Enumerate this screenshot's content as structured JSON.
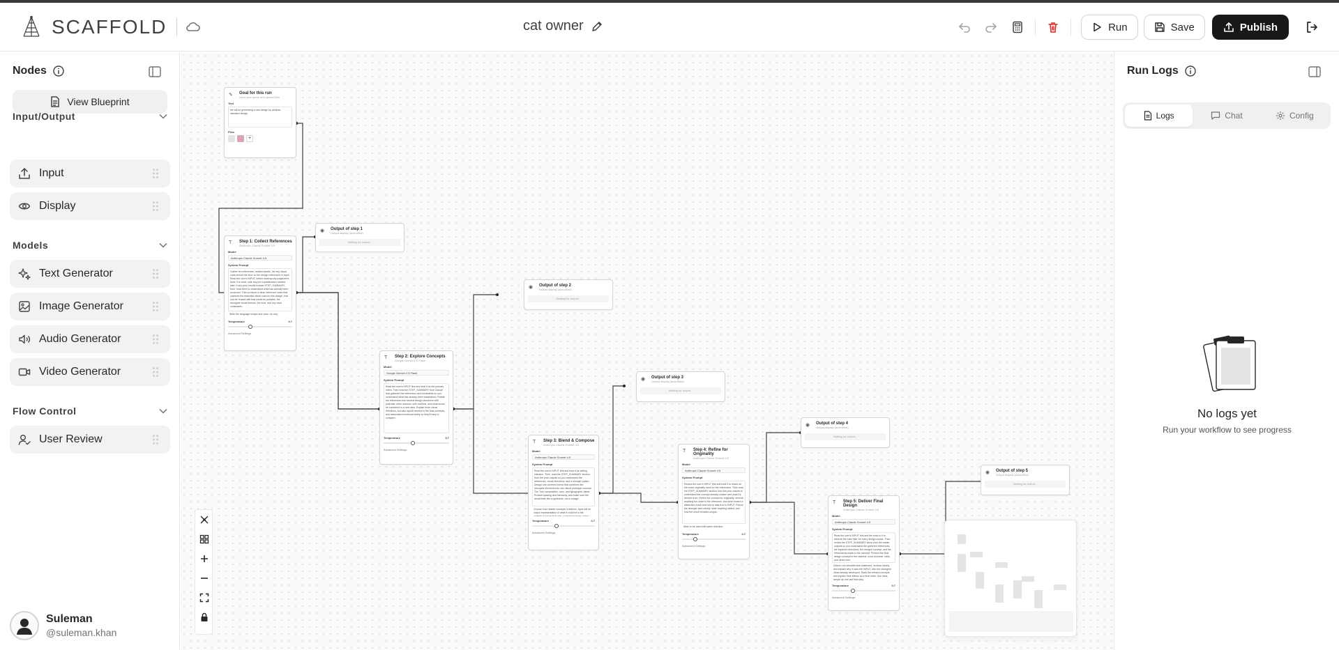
{
  "app": {
    "name": "SCAFFOLD",
    "flow_title": "cat owner"
  },
  "toolbar": {
    "run": "Run",
    "save": "Save",
    "publish": "Publish"
  },
  "sidebar": {
    "title": "Nodes",
    "view_blueprint": "View Blueprint",
    "sections": [
      {
        "title": "Input/Output",
        "items": [
          {
            "label": "Input",
            "icon": "upload-icon"
          },
          {
            "label": "Display",
            "icon": "eye-icon"
          }
        ]
      },
      {
        "title": "Models",
        "items": [
          {
            "label": "Text Generator",
            "icon": "sparkles-icon"
          },
          {
            "label": "Image Generator",
            "icon": "image-icon"
          },
          {
            "label": "Audio Generator",
            "icon": "audio-icon"
          },
          {
            "label": "Video Generator",
            "icon": "video-icon"
          }
        ]
      },
      {
        "title": "Flow Control",
        "items": [
          {
            "label": "User Review",
            "icon": "user-check-icon"
          }
        ]
      }
    ]
  },
  "user": {
    "name": "Suleman",
    "handle": "@suleman.khan"
  },
  "canvas": {
    "input_node": {
      "title": "Goal for this run",
      "subtitle": "Input your query and upload files",
      "text_label": "Text",
      "text_value": "we will be generating a new design by abstract standard design",
      "files_label": "Files"
    },
    "steps": [
      {
        "title": "Step 1: Collect References",
        "subtitle": "Anthropic Claude Sonnet 4.5",
        "model": "Anthropic Claude Sonnet 4.5",
        "prompt": "Gather ten references, related assets, the key visual cues behind the floor on the design referenced in input. Read the user's INPUT, before starting any judgement. Note: For what, note any pre-crystallization needed later. If any prior results include STEP_SUMMARY from, read them to understand what has already been produced. Then produce a clean reference index that captures the essential visual cues for this design, that can be reused with that would be portable, the strongest visual themes, the tone, and any hard constraints.",
        "tail": "Write the language simple and clear. Go sep."
      },
      {
        "title": "Step 2: Explore Concepts",
        "subtitle": "Google Gemini 2.5 Flash",
        "model": "Google Gemini 2.5 Flash",
        "prompt": "Read the user's INPUT first and treat it as the primary intent. Then read the STEP_SUMMARY from Claude that gathered the references and constraints so you understand what has already been established. Rotate the references into several design directions with potential, other reasons, with conflicts, and what would be combined in a next step. Explain three visual directions, but also layout needed to the final concepts, and associated emotional clarity so they'll easy to compare.",
        "tail": ""
      },
      {
        "title": "Step 3: Blend & Compose",
        "subtitle": "Anthropic Claude Sonnet 4.5",
        "model": "Anthropic Claude Sonnet 4.5",
        "prompt": "Read the user's INPUT first and treat it as setting intention. Then, read the STEP_SUMMARY section from the prior outputs so you understand the references, visual directions, and a stronger option. Design one coherent blend that combines the strongest elements into one visual prototype concept. The Turn composition, color, and typographic ideas. Product spacing and hierarchy, and make sure the result feels like a synthesis, not a collage.",
        "tail": "Choose how related concepts it delivers, input will an output representation of what it could be in the contextual sense that way, understand every action."
      },
      {
        "title": "Step 4: Refine for Originality",
        "subtitle": "Anthropic Claude Sonnet 4.5",
        "model": "Anthropic Claude Sonnet 4.5",
        "prompt": "Review the user's INPUT first and treat it to check on the exact originality need for the references. Then read the STEP_SUMMARY section from the prior results to understand the concept already chosen and what it's derived from. Refine the concept for originality; remove anything too close to the reference, and push toward a distinctive result and how to stay true to INPUT. Return the stronger idea clearly: state anything added, and how the result remains unique.",
        "tail": "Work to be used with same direction."
      },
      {
        "title": "Step 5: Deliver Final Design",
        "subtitle": "Anthropic Claude Sonnet 4.5",
        "model": "Anthropic Claude Sonnet 4.5",
        "prompt": "Read the user's INPUT first and the work in it to retrieve the main filter for every design choice. Then review the STEP_SUMMARY items from the earlier outputs so you understand the gathered references, the explored directions, the merged concept, and the refinements made to the concept. Present the final design concept in the clearest, most concrete, clear, and direct form.",
        "tail": "Deliver one sensible final statement, reviews clearly, and explain why it uses the INPUT, also the strongest ideas already developed. Rank the refined concepts and explain their effects as a final order. Use clear, simple as one last final step."
      }
    ],
    "outputs": [
      "Output of step 1",
      "Output of step 2",
      "Output of step 3",
      "Output of step 4",
      "Output of step 5"
    ],
    "output_subtitle": "Output display (auto-filled)",
    "waiting": "Waiting for output...",
    "labels": {
      "model": "Model",
      "system_prompt": "System Prompt",
      "temperature": "Temperature",
      "advanced": "Advanced Settings",
      "temp_value": "0.7"
    }
  },
  "run_logs": {
    "title": "Run Logs",
    "tabs": [
      "Logs",
      "Chat",
      "Config"
    ],
    "empty_title": "No logs yet",
    "empty_sub": "Run your workflow to see progress"
  }
}
